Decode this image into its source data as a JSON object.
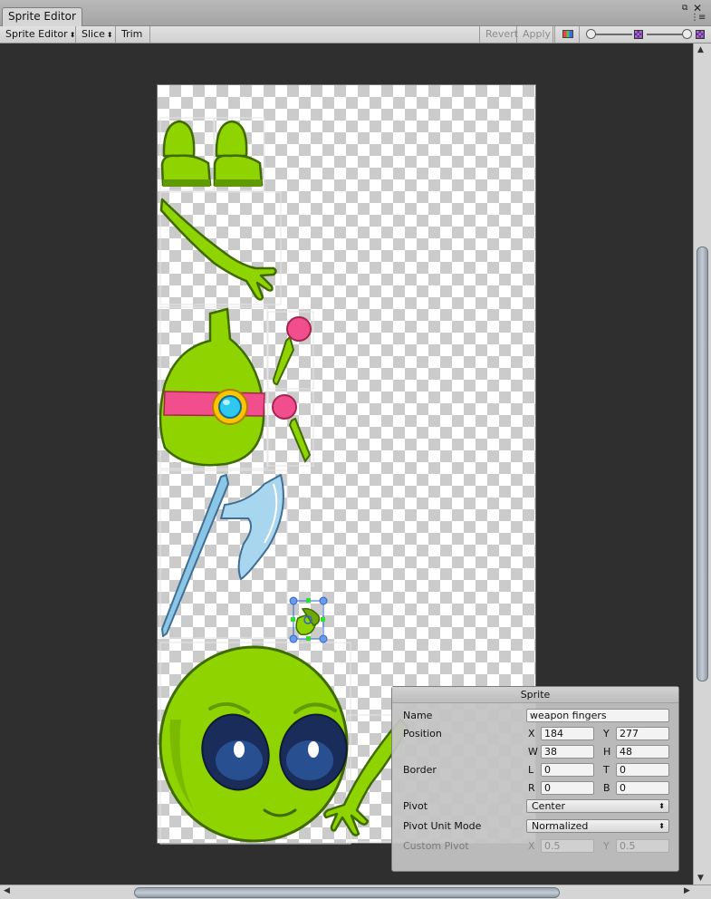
{
  "window": {
    "tab_title": "Sprite Editor",
    "maximize_glyph": "⧉",
    "close_glyph": "✕",
    "menu_glyph": "⋮≡"
  },
  "toolbar": {
    "mode_label": "Sprite Editor",
    "slice_label": "Slice",
    "trim_label": "Trim",
    "revert_label": "Revert",
    "apply_label": "Apply",
    "dropdown_glyph": "⬍"
  },
  "sprite_panel": {
    "title": "Sprite",
    "name_label": "Name",
    "name_value": "weapon fingers",
    "position_label": "Position",
    "x_label": "X",
    "x_value": "184",
    "y_label": "Y",
    "y_value": "277",
    "w_label": "W",
    "w_value": "38",
    "h_label": "H",
    "h_value": "48",
    "border_label": "Border",
    "l_label": "L",
    "l_value": "0",
    "t_label": "T",
    "t_value": "0",
    "r_label": "R",
    "r_value": "0",
    "b_label": "B",
    "b_value": "0",
    "pivot_label": "Pivot",
    "pivot_value": "Center",
    "pivot_unit_label": "Pivot Unit Mode",
    "pivot_unit_value": "Normalized",
    "custom_pivot_label": "Custom Pivot",
    "custom_x_label": "X",
    "custom_x_value": "0.5",
    "custom_y_label": "Y",
    "custom_y_value": "0.5"
  },
  "colors": {
    "alien_green": "#8fd400",
    "alien_outline": "#3f6a00",
    "pink": "#f04e8c",
    "gem": "#2ec8f0",
    "axe_blue": "#8cc6e6",
    "selection_blue": "#2b63d8"
  }
}
